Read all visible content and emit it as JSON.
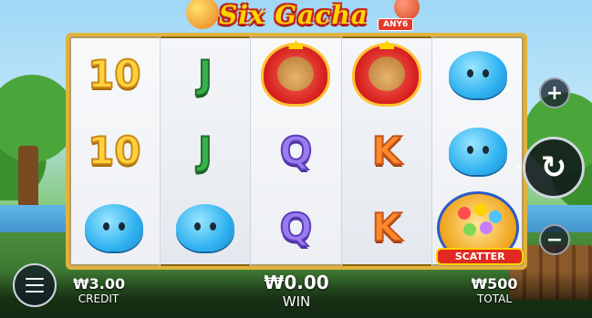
{
  "game": {
    "title": "Six Gacha",
    "badge": "ANY6"
  },
  "reels": [
    [
      "10",
      "10",
      "blue-blob"
    ],
    [
      "J",
      "J",
      "blue-blob"
    ],
    [
      "bear-heart",
      "Q",
      "Q"
    ],
    [
      "bear-heart",
      "K",
      "K"
    ],
    [
      "blue-blob",
      "blue-blob",
      "scatter"
    ]
  ],
  "symbols": {
    "scatter_label": "SCATTER"
  },
  "controls": {
    "plus_icon": "+",
    "minus_icon": "−",
    "spin_icon": "↻",
    "spin_arrow": "‹"
  },
  "stats": {
    "credit_value": "₩3.00",
    "credit_label": "CREDIT",
    "win_value": "₩0.00",
    "win_label": "WIN",
    "total_value": "₩500",
    "total_label": "TOTAL"
  },
  "colors": {
    "frame": "#e0b13b",
    "title": "#ffd400",
    "title_outline": "#c2251d"
  }
}
